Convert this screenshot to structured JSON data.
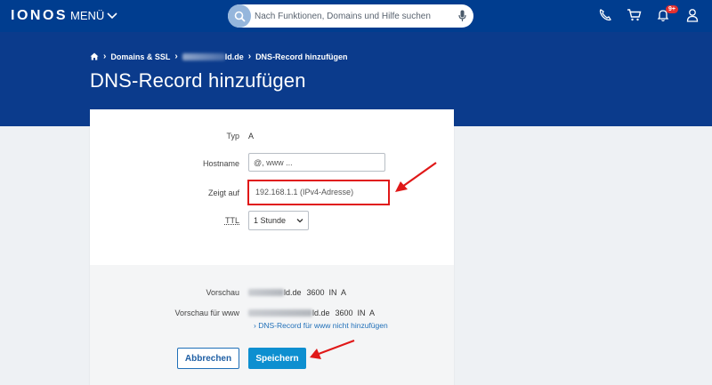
{
  "topbar": {
    "logo": "IONOS",
    "menu_label": "MENÜ",
    "search_placeholder": "Nach Funktionen, Domains und Hilfe suchen",
    "notification_badge": "9+"
  },
  "header": {
    "breadcrumb": [
      "Domains & SSL",
      "ld.de",
      "DNS-Record hinzufügen"
    ],
    "title": "DNS-Record hinzufügen"
  },
  "form": {
    "type_label": "Typ",
    "type_value": "A",
    "hostname_label": "Hostname",
    "hostname_placeholder": "@, www ...",
    "points_to_label": "Zeigt auf",
    "points_to_placeholder": "192.168.1.1 (IPv4-Adresse)",
    "ttl_label": "TTL",
    "ttl_value": "1 Stunde"
  },
  "preview": {
    "label": "Vorschau",
    "value_domain": "ld.de",
    "value_rest": "3600  IN  A",
    "www_label": "Vorschau für www",
    "www_domain": "ld.de",
    "www_rest": "3600  IN  A",
    "www_link": "DNS-Record für www nicht hinzufügen"
  },
  "buttons": {
    "cancel": "Abbrechen",
    "save": "Speichern"
  },
  "colors": {
    "brand": "#003d8f",
    "header": "#0b3b8c",
    "primary_button": "#0d8fd0",
    "annotation_red": "#e01818"
  }
}
